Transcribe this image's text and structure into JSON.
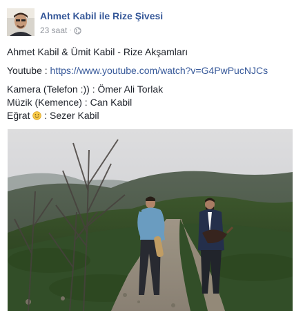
{
  "post": {
    "author_name": "Ahmet Kabil ile Rize Şivesi",
    "timestamp": "23 saat",
    "separator": "·",
    "audience_icon": "globe-icon",
    "lines": {
      "title": "Ahmet Kabil & Ümit Kabil - Rize Akşamları",
      "youtube_label": "Youtube :",
      "youtube_url": "https://www.youtube.com/watch?v=G4PwPucNJCs",
      "camera": "Kamera (Telefon :)) : Ömer Ali Torlak",
      "music": "Müzik (Kemence) : Can Kabil",
      "egrat_prefix": "Eğrat",
      "egrat_emoji": "smile-emoji-icon",
      "egrat_suffix": " : Sezer Kabil"
    }
  },
  "colors": {
    "link": "#365899",
    "meta": "#90949c",
    "text": "#1d2129"
  }
}
